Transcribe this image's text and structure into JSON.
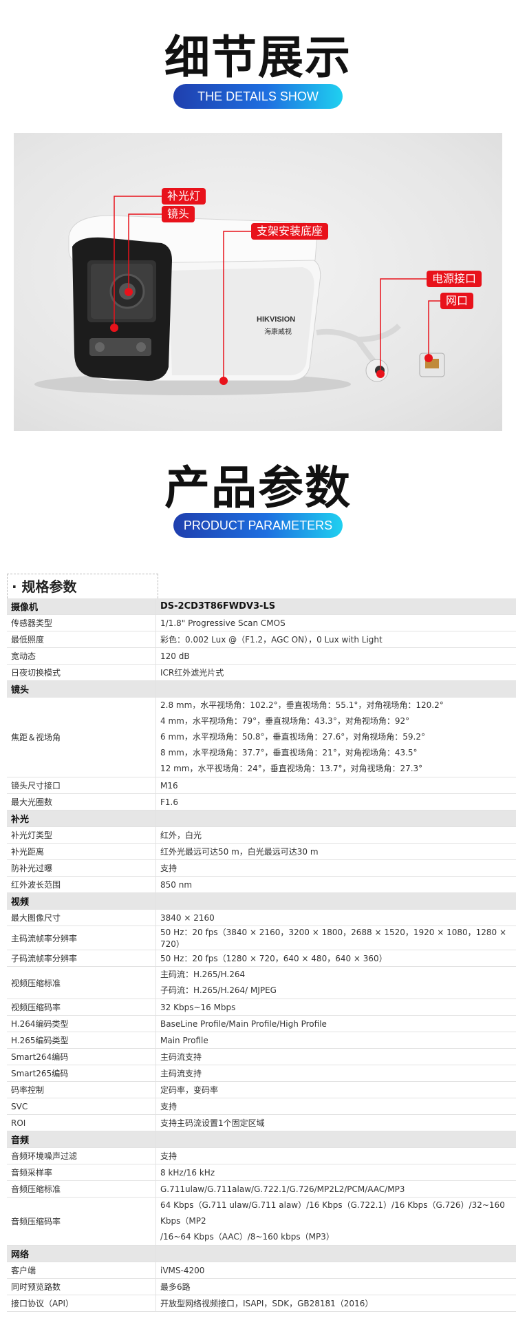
{
  "details": {
    "title": "细节展示",
    "subtitle": "THE DETAILS SHOW",
    "callouts": [
      "补光灯",
      "镜头",
      "支架安装底座",
      "电源接口",
      "网口"
    ],
    "brand_en": "HIKVISION",
    "brand_cn": "海康威视"
  },
  "params": {
    "title": "产品参数",
    "subtitle": "PRODUCT PARAMETERS"
  },
  "spec": {
    "heading": "· 规格参数",
    "rows": [
      {
        "cat": true,
        "k": "摄像机",
        "v": [
          "DS-2CD3T86FWDV3-LS"
        ]
      },
      {
        "k": "传感器类型",
        "v": [
          "1/1.8\" Progressive Scan CMOS"
        ]
      },
      {
        "k": "最低照度",
        "v": [
          "彩色：0.002 Lux @（F1.2，AGC ON），0 Lux with Light"
        ]
      },
      {
        "k": "宽动态",
        "v": [
          "120 dB"
        ]
      },
      {
        "k": "日夜切换模式",
        "v": [
          "ICR红外滤光片式"
        ]
      },
      {
        "cat": true,
        "k": "镜头",
        "v": [
          ""
        ]
      },
      {
        "k": "焦距＆视场角",
        "v": [
          "2.8 mm，水平视场角：102.2°，垂直视场角：55.1°，对角视场角：120.2°",
          "4 mm，水平视场角：79°，垂直视场角：43.3°，对角视场角：92°",
          "6 mm，水平视场角：50.8°，垂直视场角：27.6°，对角视场角：59.2°",
          "8 mm，水平视场角：37.7°，垂直视场角：21°，对角视场角：43.5°",
          "12 mm，水平视场角：24°，垂直视场角：13.7°，对角视场角：27.3°"
        ]
      },
      {
        "k": "镜头尺寸接口",
        "v": [
          "M16"
        ]
      },
      {
        "k": "最大光圈数",
        "v": [
          "F1.6"
        ]
      },
      {
        "cat": true,
        "k": "补光",
        "v": [
          ""
        ]
      },
      {
        "k": "补光灯类型",
        "v": [
          "红外，白光"
        ]
      },
      {
        "k": "补光距离",
        "v": [
          "红外光最远可达50 m，白光最远可达30 m"
        ]
      },
      {
        "k": "防补光过曝",
        "v": [
          "支持"
        ]
      },
      {
        "k": "红外波长范围",
        "v": [
          "850 nm"
        ]
      },
      {
        "cat": true,
        "k": "视频",
        "v": [
          ""
        ]
      },
      {
        "k": "最大图像尺寸",
        "v": [
          "3840 × 2160"
        ]
      },
      {
        "k": "主码流帧率分辨率",
        "v": [
          "50 Hz：20 fps（3840 × 2160，3200 × 1800，2688 × 1520，1920 × 1080，1280 × 720）"
        ]
      },
      {
        "k": "子码流帧率分辨率",
        "v": [
          "50 Hz：20 fps（1280 × 720，640 × 480，640 × 360）"
        ]
      },
      {
        "k": "视频压缩标准",
        "v": [
          "主码流：H.265/H.264",
          "子码流：H.265/H.264/ MJPEG"
        ]
      },
      {
        "k": "视频压缩码率",
        "v": [
          "32 Kbps~16 Mbps"
        ]
      },
      {
        "k": "H.264编码类型",
        "v": [
          "BaseLine Profile/Main Profile/High Profile"
        ]
      },
      {
        "k": "H.265编码类型",
        "v": [
          "Main Profile"
        ]
      },
      {
        "k": "Smart264编码",
        "v": [
          "主码流支持"
        ]
      },
      {
        "k": "Smart265编码",
        "v": [
          "主码流支持"
        ]
      },
      {
        "k": "码率控制",
        "v": [
          "定码率，变码率"
        ]
      },
      {
        "k": "SVC",
        "v": [
          "支持"
        ]
      },
      {
        "k": "ROI",
        "v": [
          "支持主码流设置1个固定区域"
        ]
      },
      {
        "cat": true,
        "k": "音频",
        "v": [
          ""
        ]
      },
      {
        "k": "音频环境噪声过滤",
        "v": [
          "支持"
        ]
      },
      {
        "k": "音频采样率",
        "v": [
          "8 kHz/16 kHz"
        ]
      },
      {
        "k": "音频压缩标准",
        "v": [
          "G.711ulaw/G.711alaw/G.722.1/G.726/MP2L2/PCM/AAC/MP3"
        ]
      },
      {
        "k": "音频压缩码率",
        "v": [
          "64 Kbps（G.711 ulaw/G.711 alaw）/16 Kbps（G.722.1）/16 Kbps（G.726）/32~160 Kbps（MP2",
          "/16~64 Kbps（AAC）/8~160 kbps（MP3）"
        ]
      },
      {
        "cat": true,
        "k": "网络",
        "v": [
          ""
        ]
      },
      {
        "k": "客户端",
        "v": [
          "iVMS-4200"
        ]
      },
      {
        "k": "同时预览路数",
        "v": [
          "最多6路"
        ]
      },
      {
        "k": "接口协议（API）",
        "v": [
          "开放型网络视频接口，ISAPI，SDK，GB28181（2016）"
        ]
      }
    ]
  }
}
